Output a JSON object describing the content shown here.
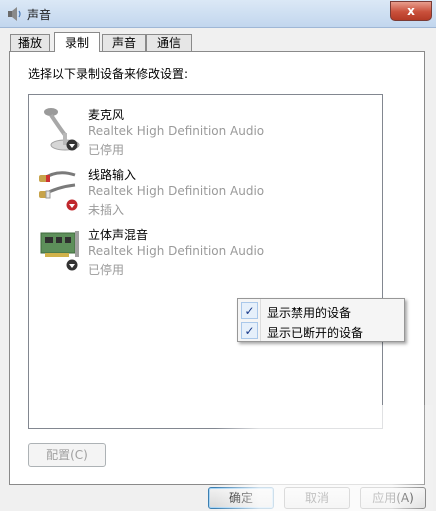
{
  "window": {
    "title": "声音",
    "close_label": "x"
  },
  "tabs": [
    {
      "label": "播放"
    },
    {
      "label": "录制"
    },
    {
      "label": "声音"
    },
    {
      "label": "通信"
    }
  ],
  "panel": {
    "instruction": "选择以下录制设备来修改设置:"
  },
  "devices": [
    {
      "name": "麦克风",
      "driver": "Realtek High Definition Audio",
      "status": "已停用",
      "icon": "microphone-icon",
      "badge": "disabled-down-arrow",
      "badge_color": "#333333"
    },
    {
      "name": "线路输入",
      "driver": "Realtek High Definition Audio",
      "status": "未插入",
      "icon": "line-in-cable-icon",
      "badge": "unplugged-down-arrow",
      "badge_color": "#c0282d"
    },
    {
      "name": "立体声混音",
      "driver": "Realtek High Definition Audio",
      "status": "已停用",
      "icon": "sound-card-icon",
      "badge": "disabled-down-arrow",
      "badge_color": "#333333"
    }
  ],
  "context_menu": {
    "items": [
      {
        "label": "显示禁用的设备",
        "checked": true
      },
      {
        "label": "显示已断开的设备",
        "checked": true
      }
    ],
    "check_glyph": "✓"
  },
  "buttons": {
    "configure": "配置(C)",
    "ok": "确定",
    "cancel": "取消",
    "apply": "应用(A)"
  }
}
